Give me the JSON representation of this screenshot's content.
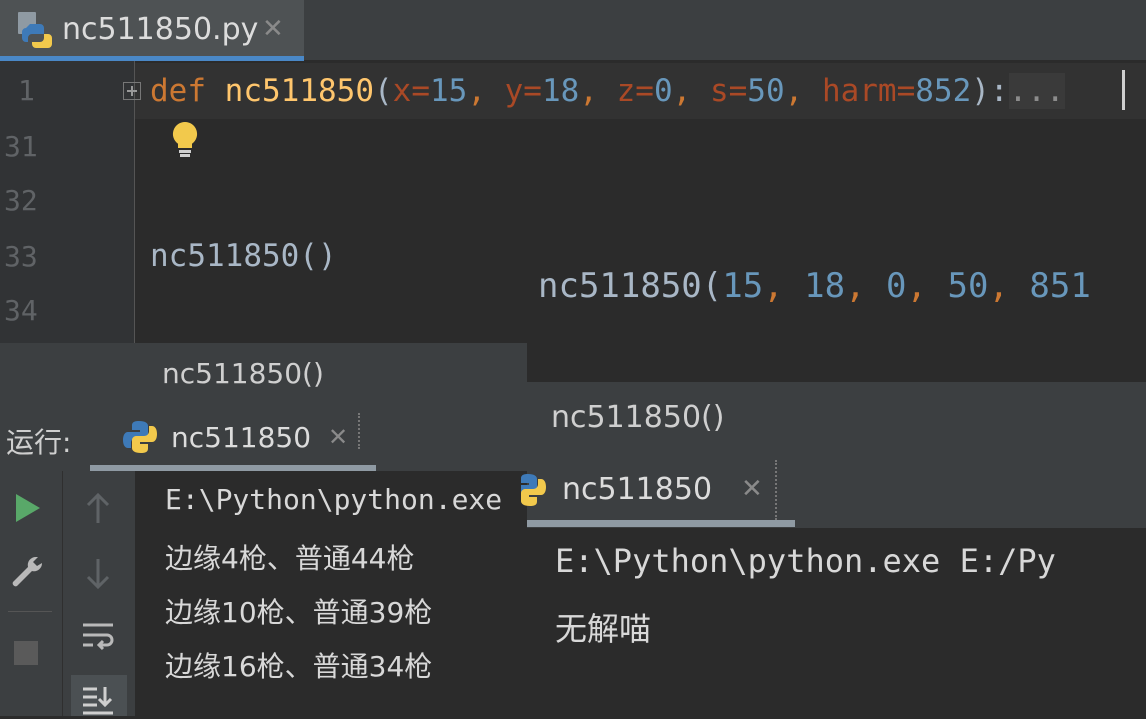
{
  "editor_tab": {
    "filename": "nc511850.py",
    "close": "✕"
  },
  "gutter": {
    "lines": [
      "1",
      "31",
      "32",
      "33",
      "34"
    ]
  },
  "code": {
    "line1": {
      "kw": "def",
      "name": "nc511850",
      "open": "(",
      "p1": "x=",
      "v1": "15",
      "c1": ", ",
      "p2": "y=",
      "v2": "18",
      "c2": ", ",
      "p3": "z=",
      "v3": "0",
      "c3": ", ",
      "p4": "s=",
      "v4": "50",
      "c4": ", ",
      "p5": "harm=",
      "v5": "852",
      "close": "):",
      "fold": "..."
    },
    "line33": "nc511850()"
  },
  "overlay_call": {
    "name": "nc511850(",
    "a1": "15",
    "s1": ", ",
    "a2": "18",
    "s2": ", ",
    "a3": "0",
    "s3": ", ",
    "a4": "50",
    "s4": ", ",
    "a5": "851"
  },
  "left_panel": {
    "breadcrumb": "nc511850()",
    "run_label": "运行:",
    "run_tab": "nc511850",
    "close": "✕",
    "console": [
      "E:\\Python\\python.exe",
      "边缘4枪、普通44枪",
      "边缘10枪、普通39枪",
      "边缘16枪、普通34枪"
    ]
  },
  "right_panel": {
    "breadcrumb": "nc511850()",
    "run_tab": "nc511850",
    "close": "✕",
    "console": [
      "E:\\Python\\python.exe E:/Py",
      "无解喵"
    ]
  },
  "colors": {
    "accent": "#4a88c7",
    "run_green": "#59a869",
    "keyword": "#cc7832",
    "function": "#ffc66d",
    "number": "#6897bb",
    "bulb": "#f2c94c"
  }
}
